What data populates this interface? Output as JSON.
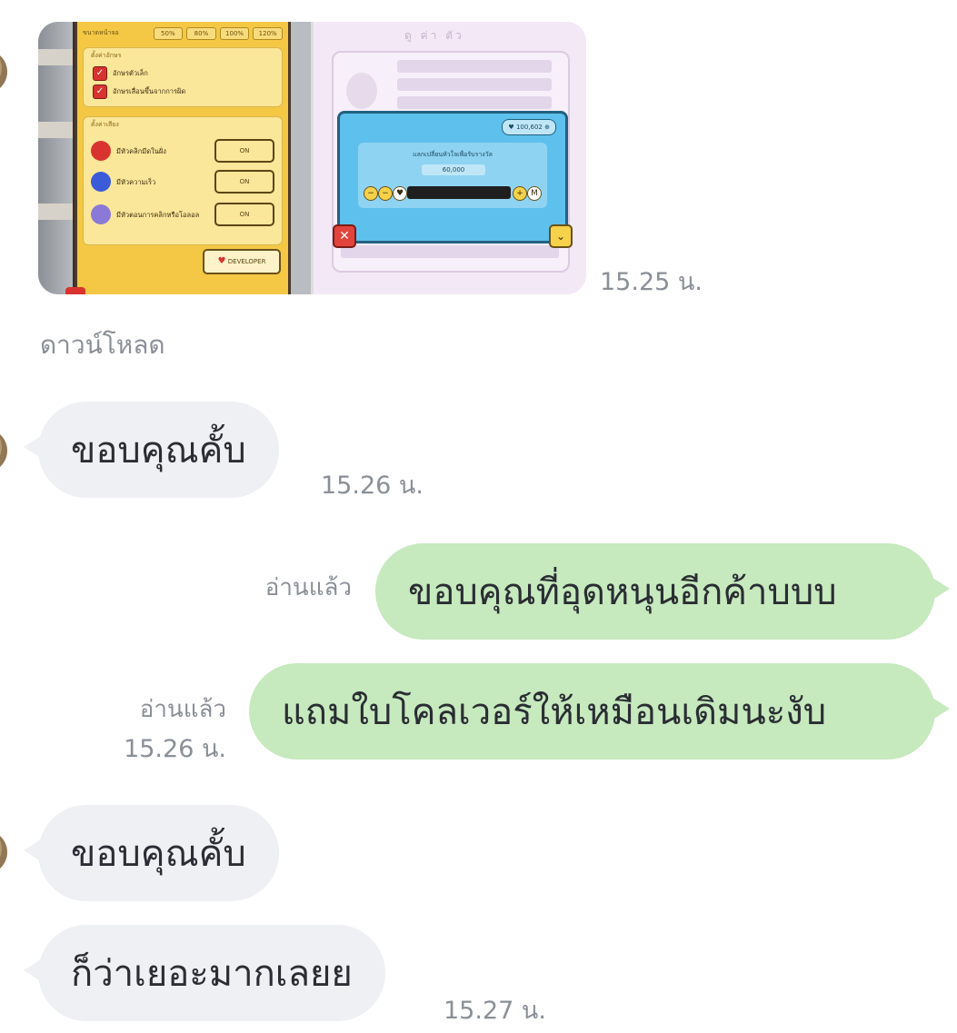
{
  "shared_image": {
    "left_pane": {
      "percent_chips": [
        "50%",
        "80%",
        "100%",
        "120%"
      ],
      "section1_title": "ตั้งค่าอักษร",
      "checkbox1_label": "อักษรตัวเล็ก",
      "checkbox2_label": "อักษรเลื่อนขึ้นจากการผิด",
      "section2_title": "ตั้งค่าเสียง",
      "options": [
        {
          "label": "มีหัวคลิกมีดในฝั่ง",
          "button": "ON"
        },
        {
          "label": "มีหัวความเร็ว",
          "button": "ON"
        },
        {
          "label": "มีหัวตอนการคลิกหรือโอลอล",
          "button": "ON"
        }
      ],
      "heart_button_label": "DEVELOPER"
    },
    "right_pane": {
      "faded_title": "ดู ค่า ตัว",
      "counter": "100,602",
      "message": "แลกเปลี่ยนหัวใจเพื่อรับรางวัล",
      "amount": "60,000"
    }
  },
  "messages": {
    "time_1": "15.25 น.",
    "download_label": "ดาวน์โหลด",
    "msg_in_1": "ขอบคุณคั้บ",
    "time_2": "15.26 น.",
    "read_1": "อ่านแล้ว",
    "msg_out_1": "ขอบคุณที่อุดหนุนอีกค้าบบบ",
    "read_2": "อ่านแล้ว",
    "time_3": "15.26 น.",
    "msg_out_2": "แถมใบโคลเวอร์ให้เหมือนเดิมนะงับ",
    "msg_in_2": "ขอบคุณคั้บ",
    "msg_in_3": "ก็ว่าเยอะมากเลยย",
    "time_4": "15.27 น."
  }
}
